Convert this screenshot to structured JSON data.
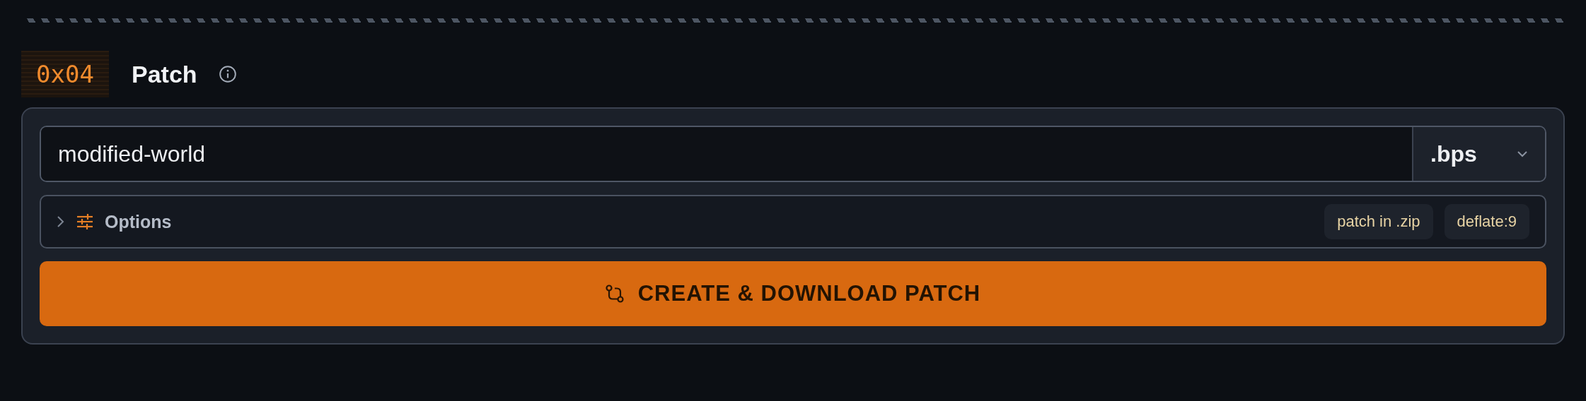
{
  "section": {
    "number": "0x04",
    "title": "Patch"
  },
  "filename": {
    "value": "modified-world"
  },
  "format": {
    "value": ".bps"
  },
  "options": {
    "label": "Options",
    "expanded": false,
    "tags": [
      "patch in .zip",
      "deflate:9"
    ]
  },
  "action_button": {
    "label": "CREATE & DOWNLOAD PATCH"
  }
}
